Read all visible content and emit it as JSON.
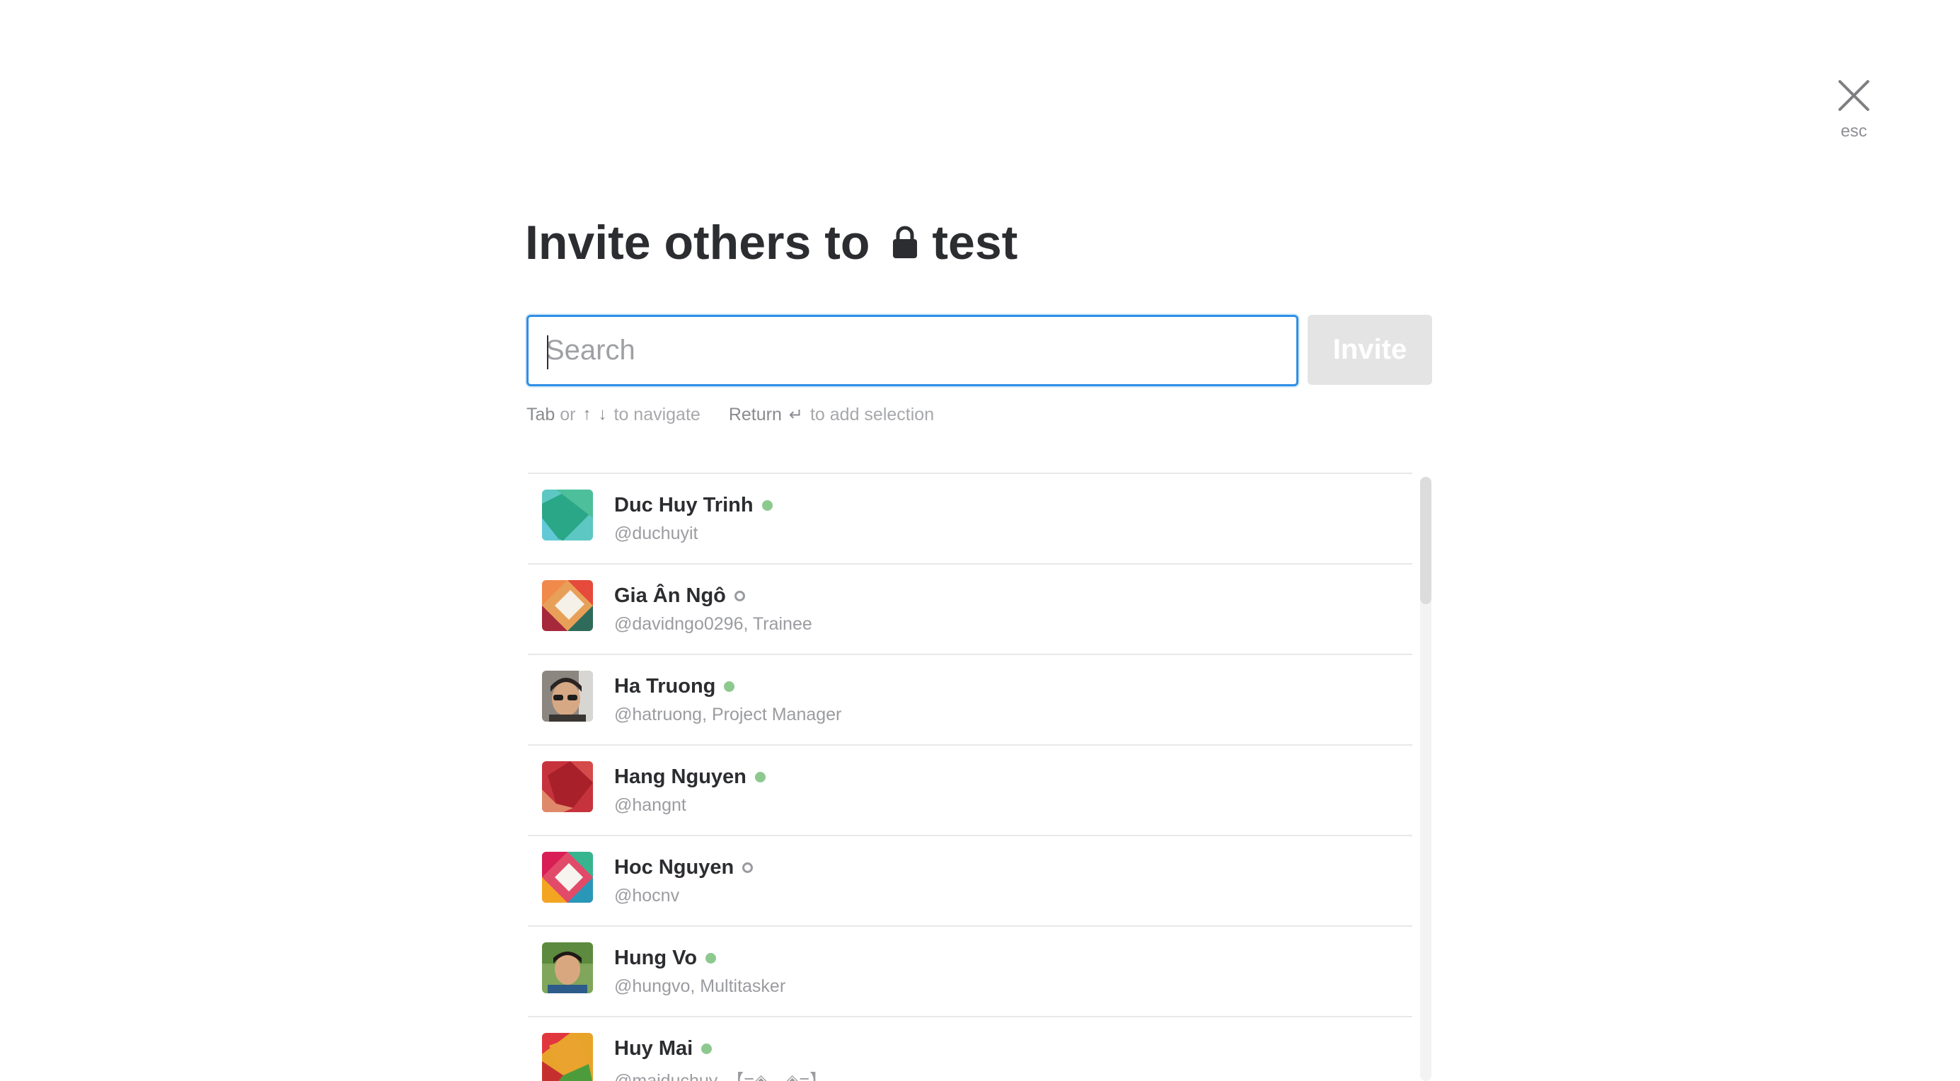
{
  "close": {
    "label": "esc",
    "icon": "close-icon"
  },
  "heading": {
    "prefix": "Invite others to",
    "channel": "test",
    "icon": "lock-icon"
  },
  "search": {
    "placeholder": "Search",
    "value": ""
  },
  "invite_button": {
    "label": "Invite"
  },
  "hint": {
    "tab": "Tab",
    "or": "or",
    "navigate": "to navigate",
    "return_key": "Return",
    "add_selection": "to add selection"
  },
  "colors": {
    "accent": "#2d8fe5",
    "active_presence": "#8dc98e",
    "disabled_button": "#e4e4e5"
  },
  "members": [
    {
      "name": "Duc Huy Trinh",
      "handle": "@duchuyit",
      "presence": "active"
    },
    {
      "name": "Gia Ân Ngô",
      "handle": "@davidngo0296, Trainee",
      "presence": "away"
    },
    {
      "name": "Ha Truong",
      "handle": "@hatruong, Project Manager",
      "presence": "active"
    },
    {
      "name": "Hang Nguyen",
      "handle": "@hangnt",
      "presence": "active"
    },
    {
      "name": "Hoc Nguyen",
      "handle": "@hocnv",
      "presence": "away"
    },
    {
      "name": "Hung Vo",
      "handle": "@hungvo, Multitasker",
      "presence": "active"
    },
    {
      "name": "Huy Mai",
      "handle": "@maiduchuy, 【=◈︿◈=】",
      "presence": "active"
    }
  ]
}
